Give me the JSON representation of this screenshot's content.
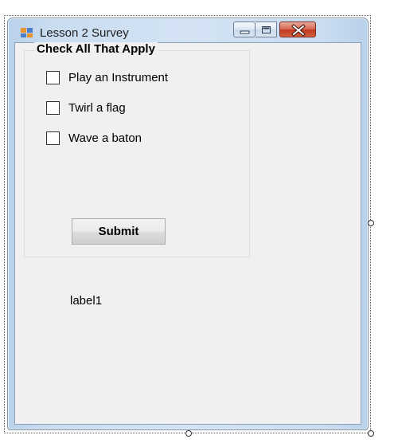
{
  "window": {
    "title": "Lesson 2 Survey",
    "app_icon": "windows-form-icon",
    "caption_buttons": [
      "minimize-icon",
      "maximize-icon",
      "close-icon"
    ]
  },
  "group": {
    "title": "Check All That Apply",
    "options": [
      {
        "label": "Play an Instrument",
        "checked": false
      },
      {
        "label": "Twirl a flag",
        "checked": false
      },
      {
        "label": "Wave a baton",
        "checked": false
      }
    ],
    "submit_label": "Submit"
  },
  "output_label": "label1",
  "colors": {
    "client_background": "#f0f0f0",
    "frame": "#c9dcf0",
    "close_button": "#c7432a"
  }
}
